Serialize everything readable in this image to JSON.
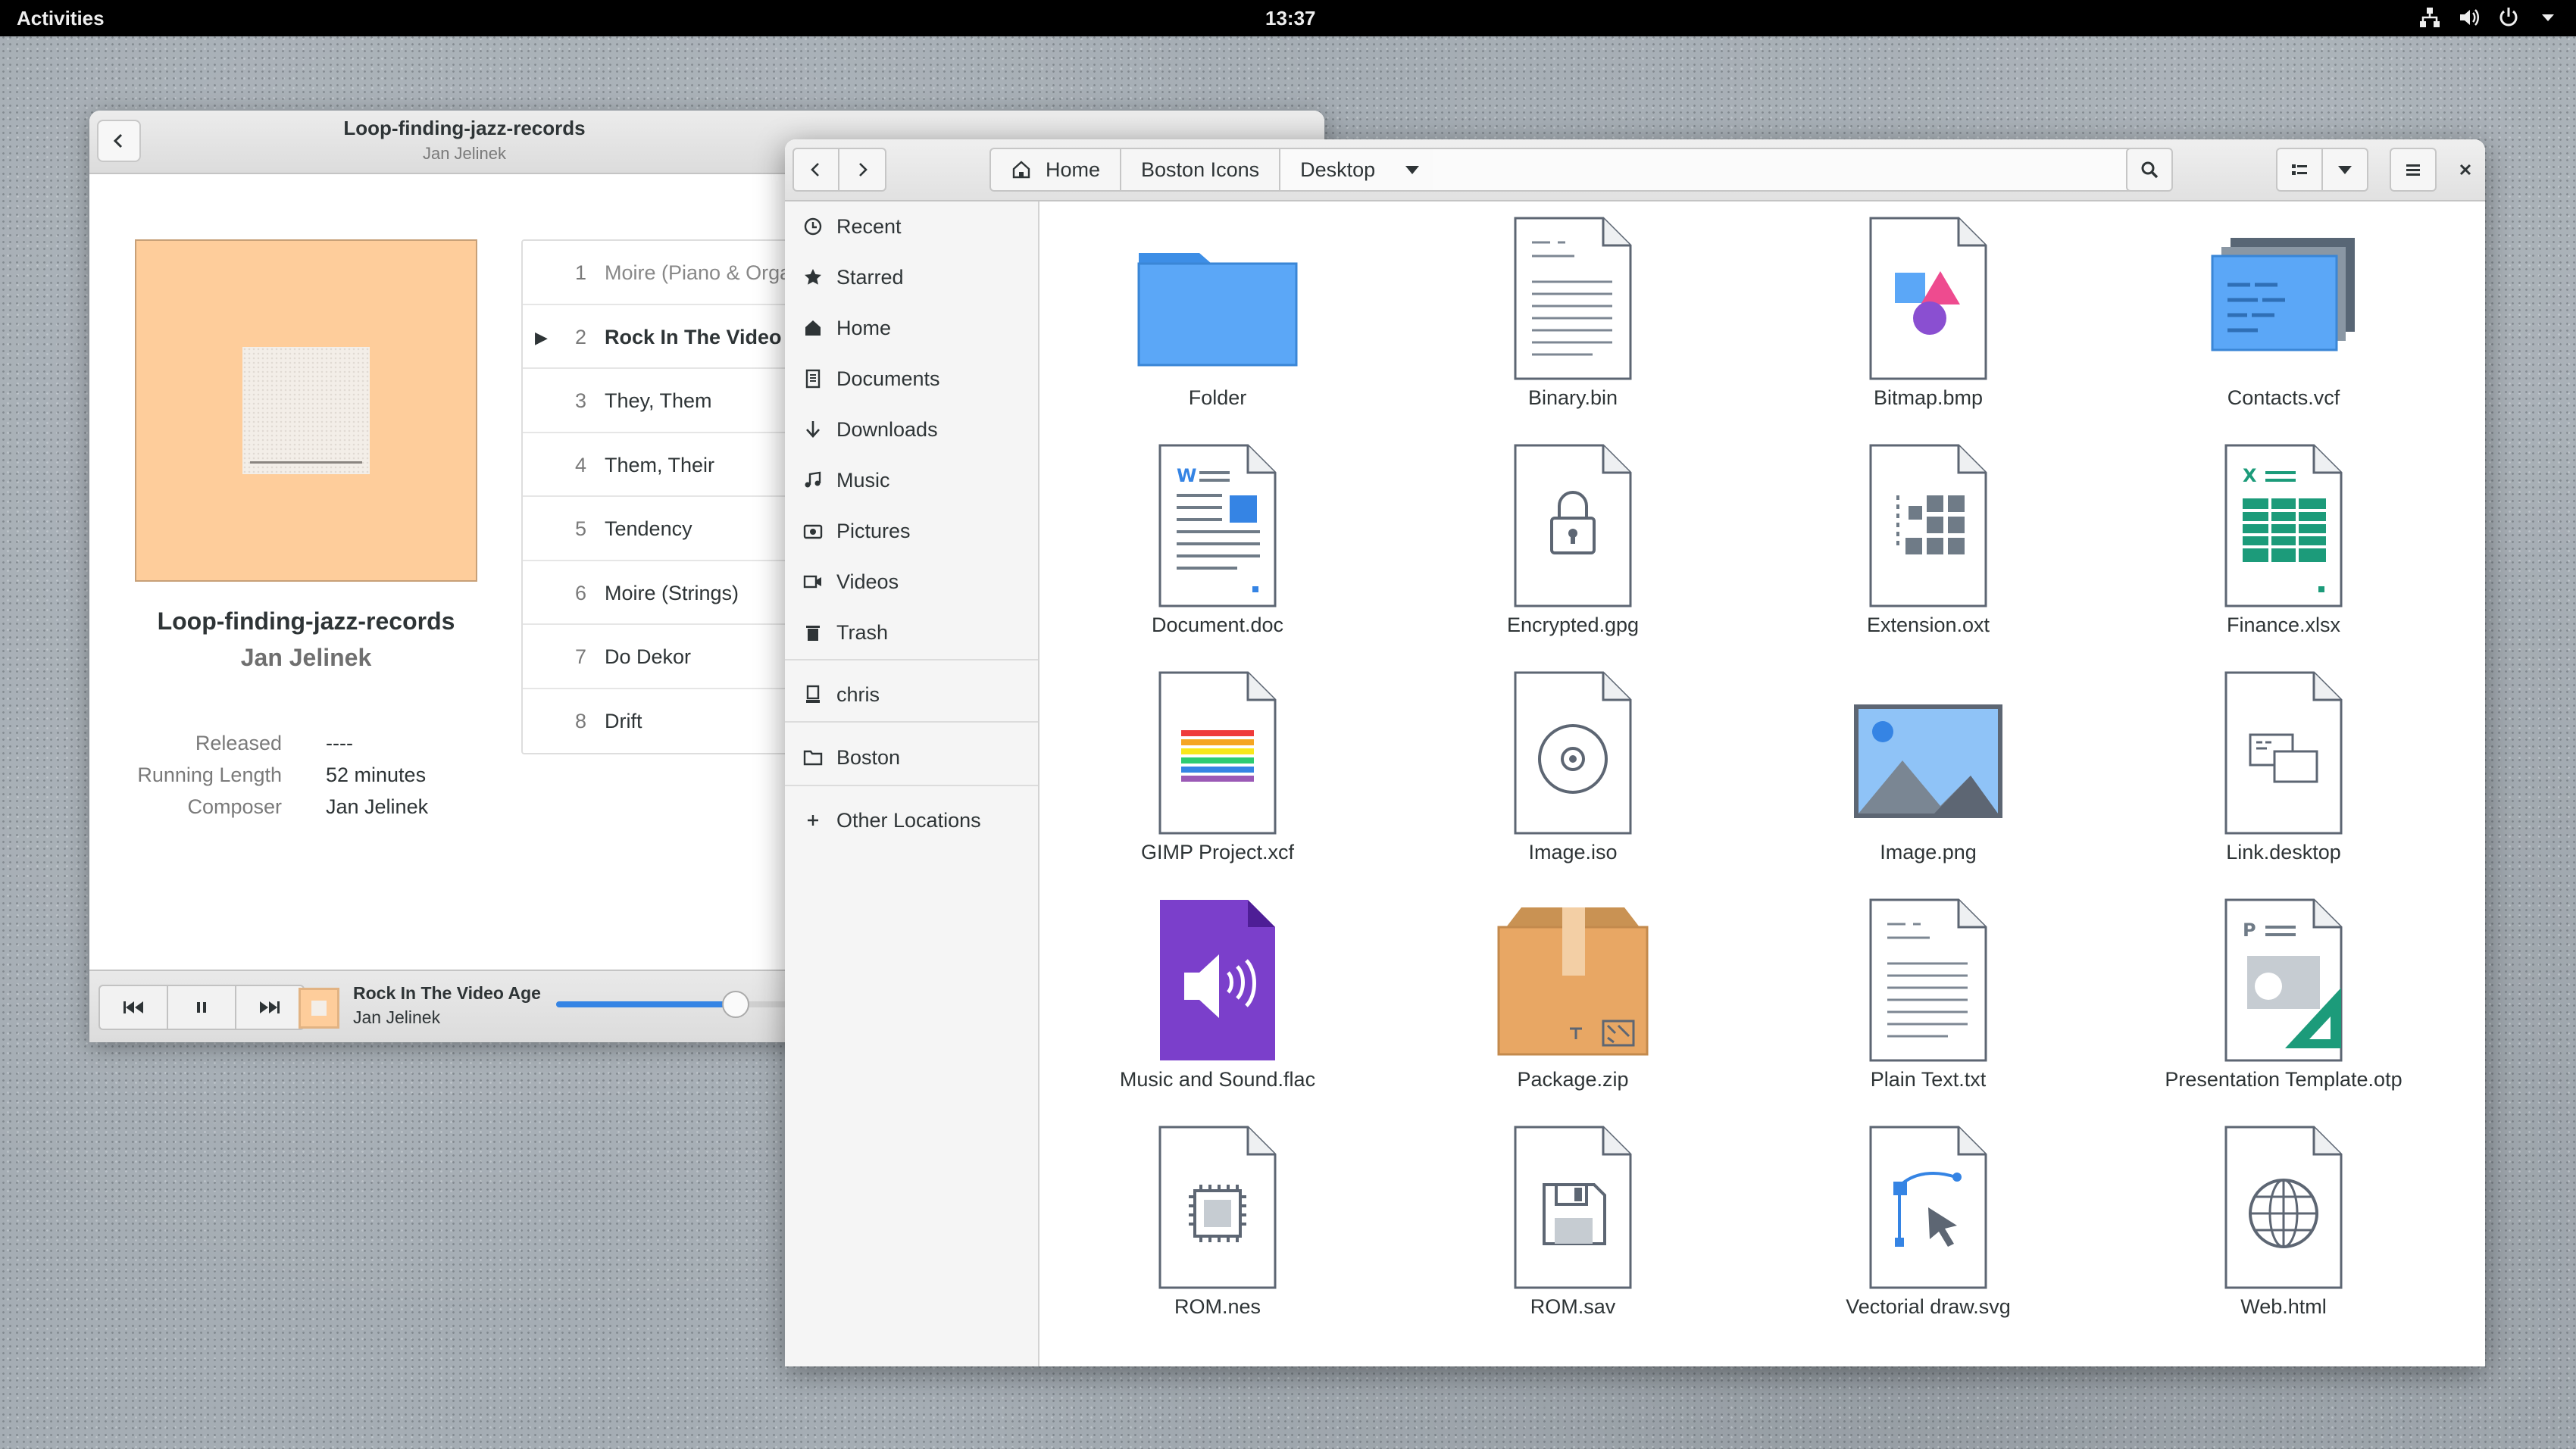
{
  "topbar": {
    "activities": "Activities",
    "clock": "13:37",
    "icons": [
      "network-icon",
      "volume-icon",
      "power-icon",
      "system-menu-icon"
    ]
  },
  "music": {
    "window_title": "Loop-finding-jazz-records",
    "window_subtitle": "Jan Jelinek",
    "album_title": "Loop-finding-jazz-records",
    "album_artist": "Jan Jelinek",
    "details": [
      {
        "key": "Released",
        "value": "----"
      },
      {
        "key": "Running Length",
        "value": "52 minutes"
      },
      {
        "key": "Composer",
        "value": "Jan Jelinek"
      }
    ],
    "tracks": [
      {
        "num": "1",
        "name": "Moire (Piano & Organ)"
      },
      {
        "num": "2",
        "name": "Rock In The Video Age"
      },
      {
        "num": "3",
        "name": "They, Them"
      },
      {
        "num": "4",
        "name": "Them, Their"
      },
      {
        "num": "5",
        "name": "Tendency"
      },
      {
        "num": "6",
        "name": "Moire (Strings)"
      },
      {
        "num": "7",
        "name": "Do Dekor"
      },
      {
        "num": "8",
        "name": "Drift"
      }
    ],
    "now_playing": {
      "title": "Rock In The Video Age",
      "artist": "Jan Jelinek",
      "progress": 0.55
    },
    "colors": {
      "cover": "#fecd9b",
      "accent": "#3584e4"
    }
  },
  "files": {
    "path": [
      "Home",
      "Boston Icons",
      "Desktop"
    ],
    "sidebar": [
      {
        "label": "Recent",
        "icon": "clock-icon"
      },
      {
        "label": "Starred",
        "icon": "star-icon"
      },
      {
        "label": "Home",
        "icon": "home-icon"
      },
      {
        "label": "Documents",
        "icon": "document-icon"
      },
      {
        "label": "Downloads",
        "icon": "download-icon"
      },
      {
        "label": "Music",
        "icon": "music-icon"
      },
      {
        "label": "Pictures",
        "icon": "camera-icon"
      },
      {
        "label": "Videos",
        "icon": "video-icon"
      },
      {
        "label": "Trash",
        "icon": "trash-icon"
      },
      {
        "label": "chris",
        "icon": "computer-icon"
      },
      {
        "label": "Boston",
        "icon": "folder-icon"
      },
      {
        "label": "Other Locations",
        "icon": "plus-icon"
      }
    ],
    "items": [
      {
        "name": "Folder",
        "icon": "folder-icon"
      },
      {
        "name": "Binary.bin",
        "icon": "text-file-icon"
      },
      {
        "name": "Bitmap.bmp",
        "icon": "bitmap-icon"
      },
      {
        "name": "Contacts.vcf",
        "icon": "contacts-icon"
      },
      {
        "name": "Document.doc",
        "icon": "word-doc-icon"
      },
      {
        "name": "Encrypted.gpg",
        "icon": "lock-file-icon"
      },
      {
        "name": "Extension.oxt",
        "icon": "extension-icon"
      },
      {
        "name": "Finance.xlsx",
        "icon": "spreadsheet-icon"
      },
      {
        "name": "GIMP Project.xcf",
        "icon": "gimp-icon"
      },
      {
        "name": "Image.iso",
        "icon": "disc-image-icon"
      },
      {
        "name": "Image.png",
        "icon": "image-icon"
      },
      {
        "name": "Link.desktop",
        "icon": "link-icon"
      },
      {
        "name": "Music and Sound.flac",
        "icon": "audio-icon"
      },
      {
        "name": "Package.zip",
        "icon": "package-icon"
      },
      {
        "name": "Plain Text.txt",
        "icon": "text-file-icon"
      },
      {
        "name": "Presentation Template.otp",
        "icon": "presentation-icon"
      },
      {
        "name": "ROM.nes",
        "icon": "chip-icon"
      },
      {
        "name": "ROM.sav",
        "icon": "floppy-icon"
      },
      {
        "name": "Vectorial draw.svg",
        "icon": "vector-icon"
      },
      {
        "name": "Web.html",
        "icon": "web-icon"
      }
    ]
  }
}
